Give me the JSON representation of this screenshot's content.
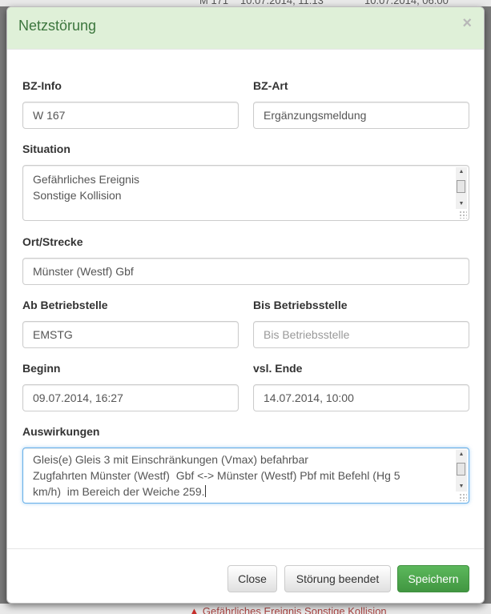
{
  "modal": {
    "title": "Netzstörung",
    "close_glyph": "×"
  },
  "fields": {
    "bz_info": {
      "label": "BZ-Info",
      "value": "W 167"
    },
    "bz_art": {
      "label": "BZ-Art",
      "value": "Ergänzungsmeldung"
    },
    "situation": {
      "label": "Situation",
      "lines": [
        "Gefährliches Ereignis",
        "Sonstige Kollision"
      ]
    },
    "ort_strecke": {
      "label": "Ort/Strecke",
      "value": "Münster (Westf) Gbf"
    },
    "ab_betriebstelle": {
      "label": "Ab Betriebstelle",
      "value": "EMSTG"
    },
    "bis_betriebsstelle": {
      "label": "Bis Betriebsstelle",
      "value": "",
      "placeholder": "Bis Betriebsstelle"
    },
    "beginn": {
      "label": "Beginn",
      "value": "09.07.2014, 16:27"
    },
    "vsl_ende": {
      "label": "vsl. Ende",
      "value": "14.07.2014, 10:00"
    },
    "auswirkungen": {
      "label": "Auswirkungen",
      "lines": [
        "Gleis(e) Gleis 3 mit Einschränkungen (Vmax) befahrbar",
        "Zugfahrten Münster (Westf)  Gbf <-> Münster (Westf) Pbf mit Befehl (Hg 5",
        "km/h)  im Bereich der Weiche 259."
      ]
    }
  },
  "footer": {
    "close_label": "Close",
    "end_disruption_label": "Störung beendet",
    "save_label": "Speichern"
  },
  "background": {
    "top_row": [
      "M 171",
      "10.07.2014, 11:13",
      "10.07.2014, 06:00"
    ],
    "bottom_row": "Gefährliches Ereignis Sonstige Kollision"
  },
  "colors": {
    "header_bg": "#dff0d8",
    "header_text": "#3c763d",
    "save_button": "#5cb85c",
    "focus_border": "#66afe9"
  }
}
